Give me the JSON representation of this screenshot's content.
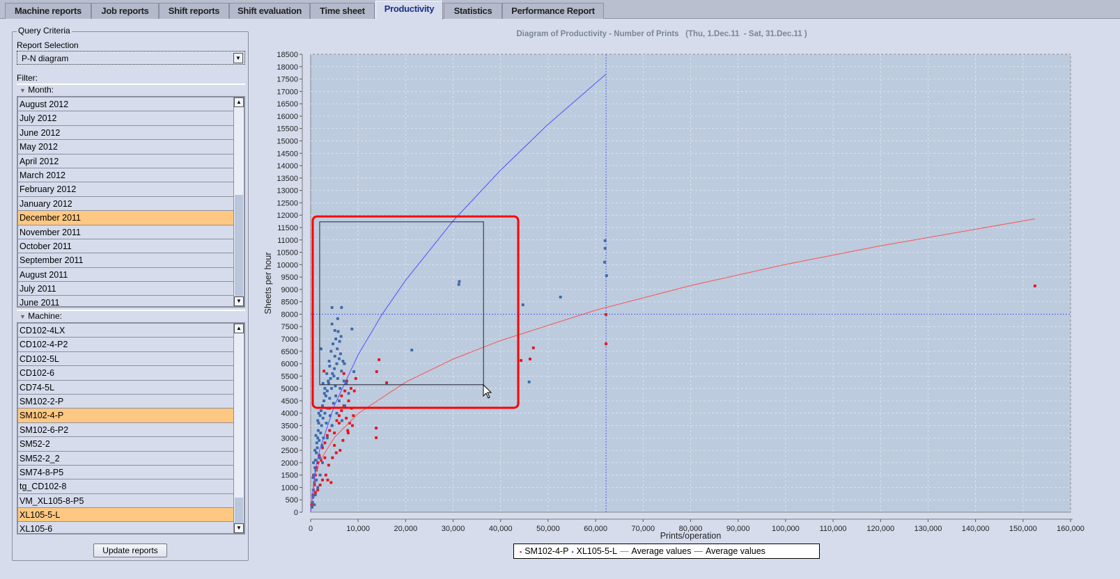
{
  "tabs": [
    {
      "label": "Machine reports",
      "active": false
    },
    {
      "label": "Job reports",
      "active": false
    },
    {
      "label": "Shift reports",
      "active": false
    },
    {
      "label": "Shift evaluation",
      "active": false
    },
    {
      "label": "Time sheet",
      "active": false
    },
    {
      "label": "Productivity",
      "active": true
    },
    {
      "label": "Statistics",
      "active": false
    },
    {
      "label": "Performance Report",
      "active": false
    }
  ],
  "query": {
    "title": "Query Criteria",
    "report_selection_label": "Report Selection",
    "report_selection_value": "P-N diagram",
    "filter_label": "Filter:",
    "month_header": "Month:",
    "months": [
      {
        "label": "August 2012",
        "selected": false
      },
      {
        "label": "July 2012",
        "selected": false
      },
      {
        "label": "June 2012",
        "selected": false
      },
      {
        "label": "May 2012",
        "selected": false
      },
      {
        "label": "April 2012",
        "selected": false
      },
      {
        "label": "March 2012",
        "selected": false
      },
      {
        "label": "February 2012",
        "selected": false
      },
      {
        "label": "January 2012",
        "selected": false
      },
      {
        "label": "December 2011",
        "selected": true
      },
      {
        "label": "November 2011",
        "selected": false
      },
      {
        "label": "October 2011",
        "selected": false
      },
      {
        "label": "September 2011",
        "selected": false
      },
      {
        "label": "August 2011",
        "selected": false
      },
      {
        "label": "July 2011",
        "selected": false
      },
      {
        "label": "June 2011",
        "selected": false
      }
    ],
    "machine_header": "Machine:",
    "machines": [
      {
        "label": "CD102-4LX",
        "selected": false
      },
      {
        "label": "CD102-4-P2",
        "selected": false
      },
      {
        "label": "CD102-5L",
        "selected": false
      },
      {
        "label": "CD102-6",
        "selected": false
      },
      {
        "label": "CD74-5L",
        "selected": false
      },
      {
        "label": "SM102-2-P",
        "selected": false
      },
      {
        "label": "SM102-4-P",
        "selected": true
      },
      {
        "label": "SM102-6-P2",
        "selected": false
      },
      {
        "label": "SM52-2",
        "selected": false
      },
      {
        "label": "SM52-2_2",
        "selected": false
      },
      {
        "label": "SM74-8-P5",
        "selected": false
      },
      {
        "label": "tg_CD102-8",
        "selected": false
      },
      {
        "label": "VM_XL105-8-P5",
        "selected": false
      },
      {
        "label": "XL105-5-L",
        "selected": true
      },
      {
        "label": "XL105-6",
        "selected": false
      }
    ],
    "update_button": "Update reports"
  },
  "colors": {
    "selected_row": "#fec882",
    "red_series": "#e8141e",
    "blue_series": "#3d6aaa",
    "red_line": "#ff5050",
    "blue_line": "#5050ff",
    "plot_bg": "#bccbde",
    "highlight_box": "#ff0000"
  },
  "chart_data": {
    "type": "scatter",
    "title": "Diagram of Productivity - Number of Prints   (Thu, 1.Dec.11  - Sat, 31.Dec.11 )",
    "xlabel": "Prints/operation",
    "ylabel": "Sheets per hour",
    "xlim": [
      0,
      160000
    ],
    "ylim": [
      0,
      18500
    ],
    "x_tick_step": 10000,
    "y_tick_step": 500,
    "grid": true,
    "legend_position": "bottom",
    "crosshair": {
      "x": 62200,
      "y": 8000
    },
    "zoom_selection": {
      "x": [
        1900,
        36400
      ],
      "y": [
        5150,
        11730
      ]
    },
    "series": [
      {
        "name": "SM102-4-P",
        "kind": "points",
        "color": "#e8141e",
        "points": [
          [
            200,
            300
          ],
          [
            500,
            700
          ],
          [
            800,
            1100
          ],
          [
            1000,
            1500
          ],
          [
            1300,
            1800
          ],
          [
            1500,
            2000
          ],
          [
            1800,
            2300
          ],
          [
            2200,
            2100
          ],
          [
            2500,
            2600
          ],
          [
            3000,
            2800
          ],
          [
            3500,
            3100
          ],
          [
            4000,
            3300
          ],
          [
            4500,
            3500
          ],
          [
            5000,
            3200
          ],
          [
            5500,
            3700
          ],
          [
            6000,
            3900
          ],
          [
            6500,
            4100
          ],
          [
            7000,
            4300
          ],
          [
            7500,
            3800
          ],
          [
            8000,
            4500
          ],
          [
            8200,
            3600
          ],
          [
            7800,
            3300
          ],
          [
            6800,
            2900
          ],
          [
            6200,
            2500
          ],
          [
            5400,
            2400
          ],
          [
            4600,
            2200
          ],
          [
            3800,
            1900
          ],
          [
            3200,
            1500
          ],
          [
            2500,
            1300
          ],
          [
            2000,
            1100
          ],
          [
            1500,
            900
          ],
          [
            4300,
            1200
          ],
          [
            3600,
            1300
          ],
          [
            9000,
            3900
          ],
          [
            8500,
            5000
          ],
          [
            7600,
            5300
          ],
          [
            7000,
            5600
          ],
          [
            6500,
            4700
          ],
          [
            7200,
            4900
          ],
          [
            8600,
            4200
          ],
          [
            8800,
            3500
          ],
          [
            9500,
            5400
          ],
          [
            7900,
            3200
          ],
          [
            6000,
            3600
          ],
          [
            5000,
            2700
          ],
          [
            4000,
            4200
          ],
          [
            3000,
            2200
          ],
          [
            1000,
            800
          ],
          [
            1200,
            1700
          ],
          [
            600,
            1500
          ],
          [
            2800,
            5700
          ],
          [
            9200,
            4900
          ],
          [
            152500,
            9140
          ],
          [
            62200,
            7990
          ],
          [
            62200,
            6800
          ],
          [
            46900,
            6640
          ],
          [
            46200,
            6190
          ],
          [
            44300,
            6130
          ],
          [
            14400,
            6160
          ],
          [
            13900,
            5680
          ],
          [
            16000,
            5230
          ],
          [
            13800,
            3400
          ],
          [
            13800,
            3010
          ]
        ]
      },
      {
        "name": "XL105-5-L",
        "kind": "points",
        "color": "#3d6aaa",
        "points": [
          [
            300,
            200
          ],
          [
            500,
            600
          ],
          [
            600,
            900
          ],
          [
            800,
            1200
          ],
          [
            400,
            400
          ],
          [
            700,
            1500
          ],
          [
            900,
            1800
          ],
          [
            1000,
            2100
          ],
          [
            1200,
            2400
          ],
          [
            1100,
            1700
          ],
          [
            1300,
            2800
          ],
          [
            1500,
            3000
          ],
          [
            1400,
            2600
          ],
          [
            1600,
            3300
          ],
          [
            1700,
            3600
          ],
          [
            1800,
            2900
          ],
          [
            2000,
            3900
          ],
          [
            2100,
            3200
          ],
          [
            2200,
            4100
          ],
          [
            1900,
            2200
          ],
          [
            2300,
            3500
          ],
          [
            2500,
            4300
          ],
          [
            2400,
            2700
          ],
          [
            2600,
            3800
          ],
          [
            2800,
            4500
          ],
          [
            3000,
            4000
          ],
          [
            2700,
            3000
          ],
          [
            3200,
            4700
          ],
          [
            3300,
            3600
          ],
          [
            3500,
            4900
          ],
          [
            3600,
            4200
          ],
          [
            3800,
            5200
          ],
          [
            4000,
            4600
          ],
          [
            4200,
            5400
          ],
          [
            4100,
            3900
          ],
          [
            4400,
            5000
          ],
          [
            4600,
            5600
          ],
          [
            4800,
            4400
          ],
          [
            5000,
            5800
          ],
          [
            5200,
            5100
          ],
          [
            5500,
            6000
          ],
          [
            5300,
            4700
          ],
          [
            5700,
            5400
          ],
          [
            6000,
            6200
          ],
          [
            6200,
            5000
          ],
          [
            6500,
            5700
          ],
          [
            6800,
            6100
          ],
          [
            7000,
            5300
          ],
          [
            3400,
            5600
          ],
          [
            3900,
            6100
          ],
          [
            4300,
            6500
          ],
          [
            4700,
            6800
          ],
          [
            5100,
            6300
          ],
          [
            5600,
            6600
          ],
          [
            6100,
            6900
          ],
          [
            6400,
            7100
          ],
          [
            5800,
            7300
          ],
          [
            4500,
            7600
          ],
          [
            5300,
            7000
          ],
          [
            2200,
            6600
          ],
          [
            4000,
            5900
          ],
          [
            3000,
            5000
          ],
          [
            2000,
            1500
          ],
          [
            1500,
            1000
          ],
          [
            1000,
            700
          ],
          [
            800,
            300
          ],
          [
            1200,
            1300
          ],
          [
            2500,
            2000
          ],
          [
            3500,
            3000
          ],
          [
            4500,
            3500
          ],
          [
            5500,
            4000
          ],
          [
            6000,
            4500
          ],
          [
            7500,
            5200
          ],
          [
            8000,
            4800
          ],
          [
            7200,
            4300
          ],
          [
            6600,
            3700
          ],
          [
            500,
            1400
          ],
          [
            900,
            2500
          ],
          [
            1700,
            4000
          ],
          [
            2900,
            4800
          ],
          [
            3700,
            5300
          ],
          [
            4900,
            5500
          ],
          [
            6300,
            6400
          ],
          [
            7100,
            6000
          ],
          [
            2600,
            5200
          ],
          [
            1500,
            3700
          ],
          [
            1100,
            3100
          ],
          [
            600,
            2000
          ],
          [
            31200,
            9200
          ],
          [
            31300,
            9320
          ],
          [
            21300,
            6550
          ],
          [
            44700,
            8380
          ],
          [
            52600,
            8690
          ],
          [
            46000,
            5260
          ],
          [
            62000,
            10970
          ],
          [
            62000,
            10660
          ],
          [
            61900,
            10100
          ],
          [
            62300,
            9560
          ],
          [
            4500,
            8270
          ],
          [
            6500,
            8270
          ],
          [
            8700,
            7400
          ],
          [
            5700,
            7820
          ],
          [
            5100,
            7340
          ],
          [
            9100,
            5680
          ]
        ]
      },
      {
        "name": "Average values",
        "kind": "line",
        "color": "#ff5050",
        "points": [
          [
            0,
            0
          ],
          [
            1000,
            1585
          ],
          [
            2000,
            2090
          ],
          [
            5000,
            3020
          ],
          [
            10000,
            3985
          ],
          [
            20000,
            5255
          ],
          [
            30000,
            6185
          ],
          [
            40000,
            6935
          ],
          [
            60000,
            8160
          ],
          [
            80000,
            9155
          ],
          [
            100000,
            10010
          ],
          [
            120000,
            10760
          ],
          [
            152500,
            11850
          ]
        ]
      },
      {
        "name": "Average values",
        "kind": "line",
        "color": "#5050ff",
        "points": [
          [
            0,
            0
          ],
          [
            1000,
            1750
          ],
          [
            2000,
            2580
          ],
          [
            5000,
            4310
          ],
          [
            10000,
            6360
          ],
          [
            15000,
            7980
          ],
          [
            20000,
            9370
          ],
          [
            30000,
            11770
          ],
          [
            40000,
            13820
          ],
          [
            50000,
            15670
          ],
          [
            62200,
            17700
          ]
        ]
      }
    ]
  }
}
